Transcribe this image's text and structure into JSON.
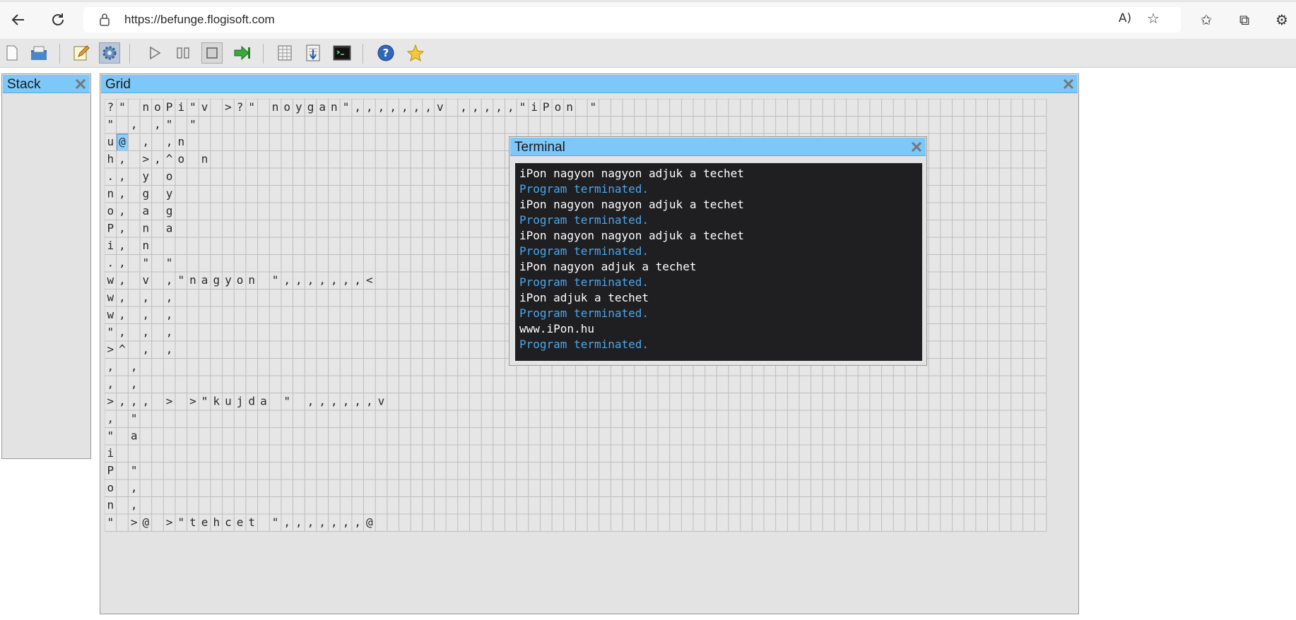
{
  "browser": {
    "url": "https://befunge.flogisoft.com"
  },
  "toolbar": {
    "buttons": [
      {
        "name": "new-file",
        "icon": "new-file-icon"
      },
      {
        "name": "open",
        "icon": "open-folder-icon"
      },
      {
        "name": "edit",
        "icon": "edit-pencil-icon"
      },
      {
        "name": "settings",
        "icon": "gear-icon",
        "active": true
      },
      {
        "name": "run",
        "icon": "play-icon"
      },
      {
        "name": "pause",
        "icon": "pause-icon"
      },
      {
        "name": "stop",
        "icon": "stop-icon"
      },
      {
        "name": "step",
        "icon": "step-icon"
      },
      {
        "name": "grid-view",
        "icon": "grid-icon"
      },
      {
        "name": "stack-view",
        "icon": "stack-icon"
      },
      {
        "name": "terminal-view",
        "icon": "terminal-icon"
      },
      {
        "name": "help",
        "icon": "help-icon"
      },
      {
        "name": "about",
        "icon": "star-icon"
      }
    ]
  },
  "stack": {
    "title": "Stack"
  },
  "grid": {
    "title": "Grid",
    "cursor_cell": {
      "row": 2,
      "col": 1
    },
    "rows": [
      "?\"  noPi\"v  >?\"  noygan\",,,,,,,v                                 ,,,,,\"iPon  \"",
      "\"         , ,\"                 \"",
      "u@        , ,n",
      "h,        >,^o                 n",
      ".,           y                 o",
      "n,           g                 y",
      "o,           a                 g",
      "P,           n                 a",
      "i,                             n",
      ".,           \"                 \"",
      "w,        v  ,\"nagyon  \",,,,,,,<",
      "w,        , ,",
      "w,        , ,",
      "\",        , ,",
      ">^        , ,",
      "          , ,",
      "          , ,",
      ">,,,      > >\"kujda  \" ,,,,,,v",
      ",                            \"",
      "\"                            a",
      "i",
      "P                            \"",
      "o                            ,",
      "n                            ,",
      "\"           >@                >\"tehcet  \",,,,,,,@"
    ]
  },
  "terminal": {
    "title": "Terminal",
    "lines": [
      {
        "text": "iPon nagyon nagyon adjuk a techet",
        "kind": "out"
      },
      {
        "text": "Program terminated.",
        "kind": "info"
      },
      {
        "text": "iPon nagyon nagyon adjuk a techet",
        "kind": "out"
      },
      {
        "text": "Program terminated.",
        "kind": "info"
      },
      {
        "text": "iPon nagyon nagyon adjuk a techet",
        "kind": "out"
      },
      {
        "text": "Program terminated.",
        "kind": "info"
      },
      {
        "text": "iPon nagyon adjuk a techet",
        "kind": "out"
      },
      {
        "text": "Program terminated.",
        "kind": "info"
      },
      {
        "text": "iPon adjuk a techet",
        "kind": "out"
      },
      {
        "text": "Program terminated.",
        "kind": "info"
      },
      {
        "text": "www.iPon.hu",
        "kind": "out"
      },
      {
        "text": "Program terminated.",
        "kind": "info"
      }
    ]
  },
  "colors": {
    "panel_title_bg": "#7cc8f8",
    "terminal_bg": "#1f1f22",
    "terminal_info": "#4aa6ea",
    "cursor_bg": "#8fd0ff"
  }
}
